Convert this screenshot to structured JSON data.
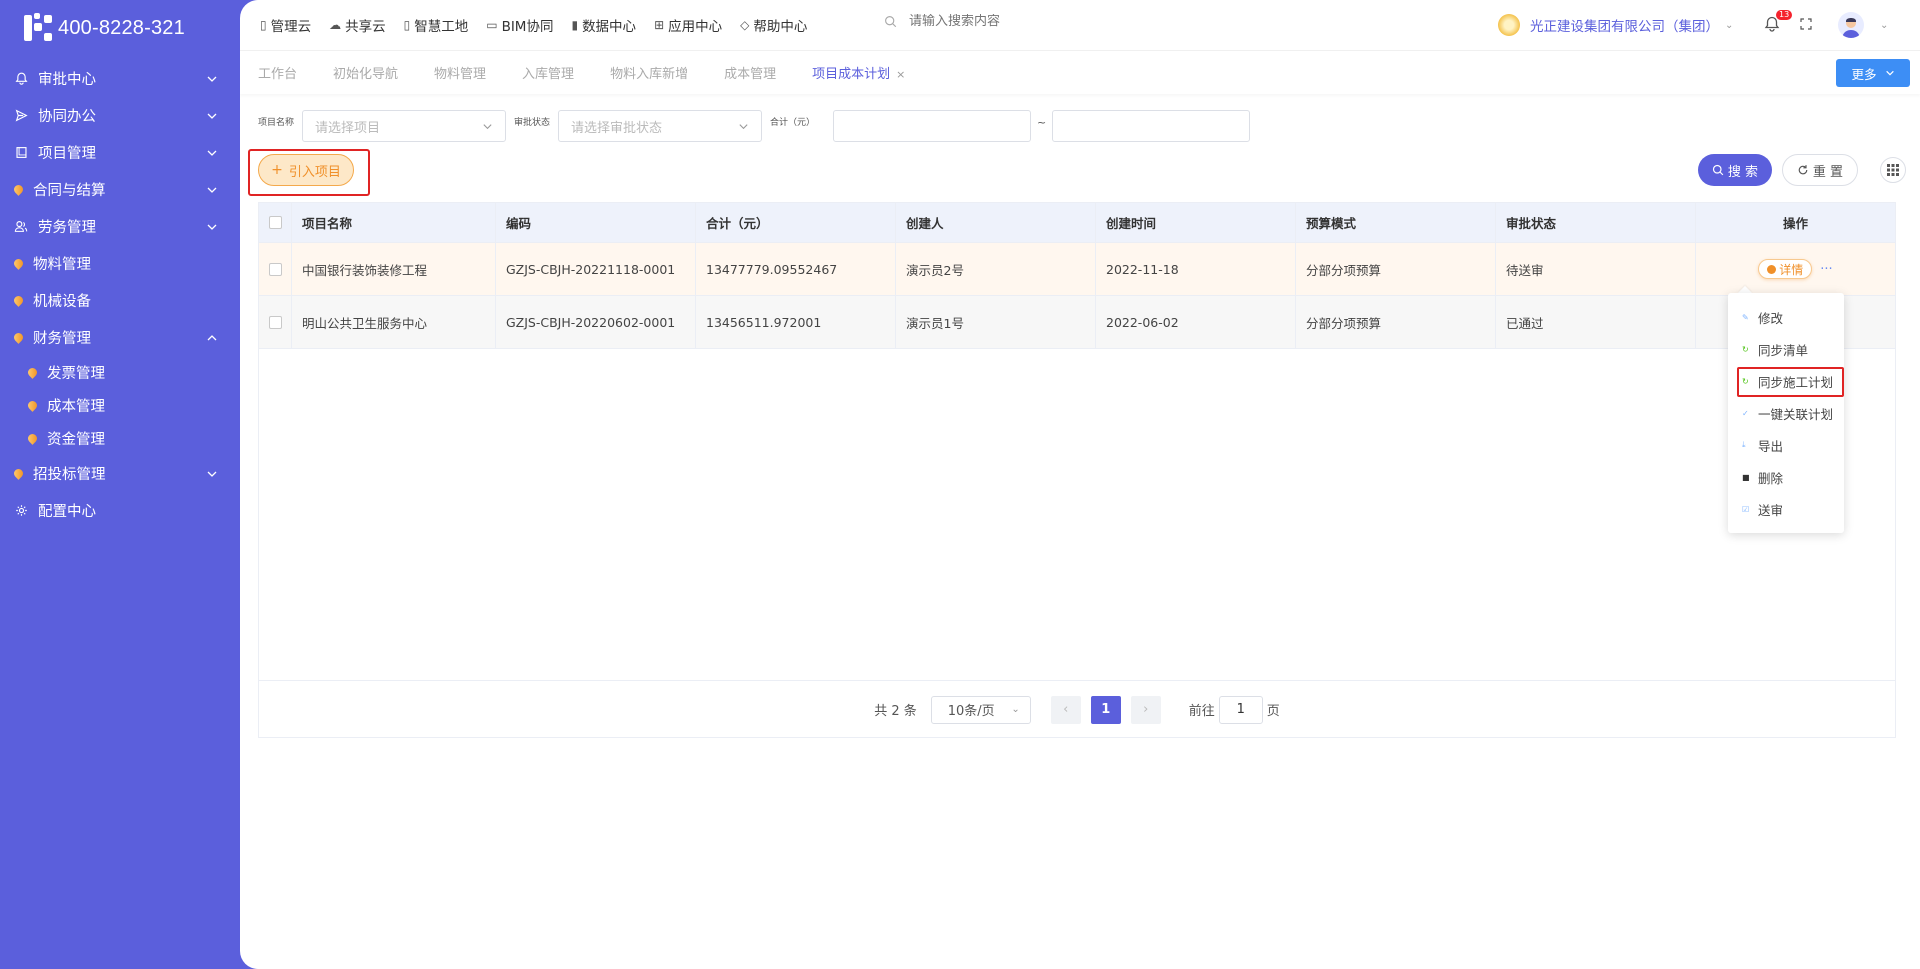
{
  "brand": {
    "phone": "400-8228-321"
  },
  "sidebar": {
    "items": [
      {
        "label": "审批中心",
        "icon": "bell-icon",
        "expandable": true
      },
      {
        "label": "协同办公",
        "icon": "send-icon",
        "expandable": true
      },
      {
        "label": "项目管理",
        "icon": "book-icon",
        "expandable": true
      },
      {
        "label": "合同与结算",
        "icon": "gem-dot-icon",
        "expandable": true
      },
      {
        "label": "劳务管理",
        "icon": "users-icon",
        "expandable": true
      },
      {
        "label": "物料管理",
        "icon": "gem-dot-icon",
        "expandable": false
      },
      {
        "label": "机械设备",
        "icon": "gem-dot-icon",
        "expandable": false
      },
      {
        "label": "财务管理",
        "icon": "gem-dot-icon",
        "expandable": true,
        "expanded": true
      },
      {
        "label": "招投标管理",
        "icon": "gem-dot-icon",
        "expandable": true
      },
      {
        "label": "配置中心",
        "icon": "gear-icon",
        "expandable": false
      }
    ],
    "finance_children": [
      "发票管理",
      "成本管理",
      "资金管理"
    ]
  },
  "topnav": {
    "items": [
      "管理云",
      "共享云",
      "智慧工地",
      "BIM协同",
      "数据中心",
      "应用中心",
      "帮助中心"
    ],
    "search_placeholder": "请输入搜索内容",
    "company": "光正建设集团有限公司（集团）",
    "notification_count": "13"
  },
  "tabs": {
    "items": [
      "工作台",
      "初始化导航",
      "物料管理",
      "入库管理",
      "物料入库新增",
      "成本管理",
      "项目成本计划"
    ],
    "active_index": 6,
    "close_glyph": "×",
    "more_label": "更多"
  },
  "filters": {
    "project_label": "项目名称",
    "project_placeholder": "请选择项目",
    "status_label": "审批状态",
    "status_placeholder": "请选择审批状态",
    "total_label": "合计（元）",
    "range_sep": "~"
  },
  "actions": {
    "import_label": "引入项目",
    "search_label": "搜 索",
    "reset_label": "重 置"
  },
  "table": {
    "columns": [
      "项目名称",
      "编码",
      "合计（元）",
      "创建人",
      "创建时间",
      "预算模式",
      "审批状态",
      "操作"
    ],
    "rows": [
      {
        "name": "中国银行装饰装修工程",
        "code": "GZJS-CBJH-20221118-0001",
        "total": "13477779.09552467",
        "creator": "演示员2号",
        "created": "2022-11-18",
        "mode": "分部分项预算",
        "status": "待送审"
      },
      {
        "name": "明山公共卫生服务中心",
        "code": "GZJS-CBJH-20220602-0001",
        "total": "13456511.972001",
        "creator": "演示员1号",
        "created": "2022-06-02",
        "mode": "分部分项预算",
        "status": "已通过"
      }
    ],
    "detail_label": "详情",
    "more_glyph": "···"
  },
  "pager": {
    "total_text": "共 2 条",
    "page_size": "10条/页",
    "current_page": "1",
    "goto_prefix": "前往",
    "goto_value": "1",
    "goto_suffix": "页"
  },
  "row_menu": {
    "items": [
      {
        "label": "修改",
        "icon": "edit-icon"
      },
      {
        "label": "同步清单",
        "icon": "sync-icon"
      },
      {
        "label": "同步施工计划",
        "icon": "sync-icon",
        "highlighted": true
      },
      {
        "label": "一键关联计划",
        "icon": "link-icon"
      },
      {
        "label": "导出",
        "icon": "export-icon"
      },
      {
        "label": "删除",
        "icon": "trash-icon"
      },
      {
        "label": "送审",
        "icon": "submit-icon"
      }
    ]
  },
  "colors": {
    "primary": "#5b5fdc",
    "accent_orange": "#f0902a",
    "highlight_red": "#e02424",
    "more_button_blue": "#3d8ef5"
  }
}
